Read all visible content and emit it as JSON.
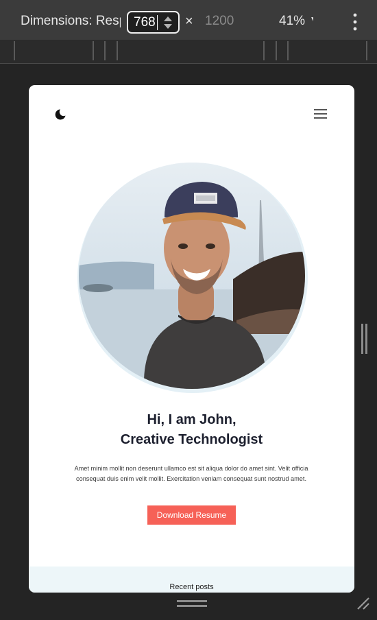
{
  "toolbar": {
    "dimensions_label": "Dimensions: Responsive",
    "width_value": "768",
    "times_symbol": "×",
    "height_value": "1200",
    "zoom_value": "41% ▼"
  },
  "page": {
    "hero": {
      "greeting": "Hi, I am John,",
      "role": "Creative Technologist",
      "description": "Amet minim mollit non deserunt ullamco est sit aliqua dolor do amet sint. Velit officia consequat duis enim velit mollit. Exercitation veniam consequat sunt nostrud amet.",
      "download_label": "Download Resume"
    },
    "recent_posts_label": "Recent posts"
  },
  "colors": {
    "accent": "#f66157",
    "title": "#1c1f2e",
    "section_bg": "#edf6f9"
  }
}
